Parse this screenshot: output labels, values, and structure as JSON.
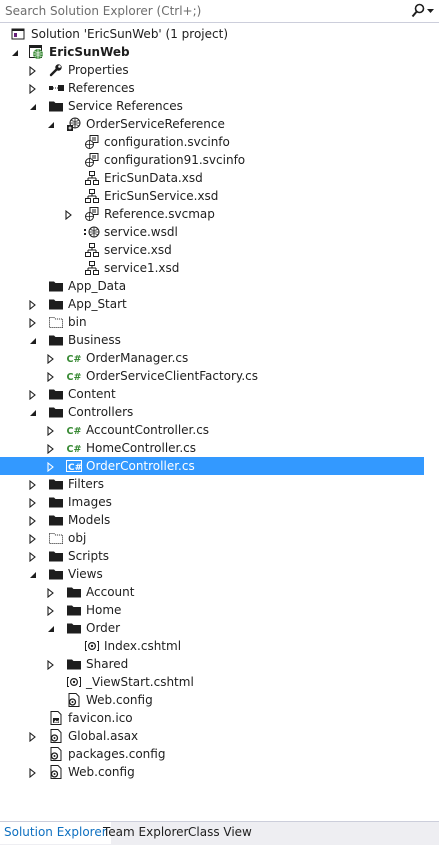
{
  "search": {
    "placeholder": "Search Solution Explorer (Ctrl+;)",
    "icon": "search-icon"
  },
  "tree": [
    {
      "label": "Solution 'EricSunWeb' (1 project)",
      "level": 0,
      "expander": "none",
      "icon": "solution",
      "name": "tree-item-solution"
    },
    {
      "label": "EricSunWeb",
      "level": 0,
      "expander": "expanded",
      "icon": "web-project",
      "bold": true,
      "name": "tree-item-ericsunweb"
    },
    {
      "label": "Properties",
      "level": 1,
      "expander": "collapsed",
      "icon": "wrench",
      "name": "tree-item-properties"
    },
    {
      "label": "References",
      "level": 1,
      "expander": "collapsed",
      "icon": "references",
      "name": "tree-item-references"
    },
    {
      "label": "Service References",
      "level": 1,
      "expander": "expanded",
      "icon": "folder",
      "name": "tree-item-service-references"
    },
    {
      "label": "OrderServiceReference",
      "level": 2,
      "expander": "expanded",
      "icon": "service-reference",
      "name": "tree-item-orderservicereference"
    },
    {
      "label": "configuration.svcinfo",
      "level": 3,
      "expander": "none",
      "icon": "svcinfo",
      "name": "tree-item-configuration-svcinfo"
    },
    {
      "label": "configuration91.svcinfo",
      "level": 3,
      "expander": "none",
      "icon": "svcinfo",
      "name": "tree-item-configuration91-svcinfo"
    },
    {
      "label": "EricSunData.xsd",
      "level": 3,
      "expander": "none",
      "icon": "xsd",
      "name": "tree-item-ericsundata-xsd"
    },
    {
      "label": "EricSunService.xsd",
      "level": 3,
      "expander": "none",
      "icon": "xsd",
      "name": "tree-item-ericsunservice-xsd"
    },
    {
      "label": "Reference.svcmap",
      "level": 3,
      "expander": "collapsed",
      "icon": "svcinfo",
      "name": "tree-item-reference-svcmap"
    },
    {
      "label": "service.wsdl",
      "level": 3,
      "expander": "none",
      "icon": "wsdl",
      "name": "tree-item-service-wsdl"
    },
    {
      "label": "service.xsd",
      "level": 3,
      "expander": "none",
      "icon": "xsd",
      "name": "tree-item-service-xsd"
    },
    {
      "label": "service1.xsd",
      "level": 3,
      "expander": "none",
      "icon": "xsd",
      "name": "tree-item-service1-xsd"
    },
    {
      "label": "App_Data",
      "level": 1,
      "expander": "none",
      "icon": "folder",
      "name": "tree-item-app-data"
    },
    {
      "label": "App_Start",
      "level": 1,
      "expander": "collapsed",
      "icon": "folder",
      "name": "tree-item-app-start"
    },
    {
      "label": "bin",
      "level": 1,
      "expander": "collapsed",
      "icon": "folder-hidden",
      "name": "tree-item-bin"
    },
    {
      "label": "Business",
      "level": 1,
      "expander": "expanded",
      "icon": "folder",
      "name": "tree-item-business"
    },
    {
      "label": "OrderManager.cs",
      "level": 2,
      "expander": "collapsed",
      "icon": "csharp",
      "name": "tree-item-ordermanager-cs"
    },
    {
      "label": "OrderServiceClientFactory.cs",
      "level": 2,
      "expander": "collapsed",
      "icon": "csharp",
      "name": "tree-item-orderserviceclientfactory-cs"
    },
    {
      "label": "Content",
      "level": 1,
      "expander": "collapsed",
      "icon": "folder",
      "name": "tree-item-content"
    },
    {
      "label": "Controllers",
      "level": 1,
      "expander": "expanded",
      "icon": "folder",
      "name": "tree-item-controllers"
    },
    {
      "label": "AccountController.cs",
      "level": 2,
      "expander": "collapsed",
      "icon": "csharp",
      "name": "tree-item-accountcontroller-cs"
    },
    {
      "label": "HomeController.cs",
      "level": 2,
      "expander": "collapsed",
      "icon": "csharp",
      "name": "tree-item-homecontroller-cs"
    },
    {
      "label": "OrderController.cs",
      "level": 2,
      "expander": "collapsed",
      "icon": "csharp",
      "selected": true,
      "name": "tree-item-ordercontroller-cs"
    },
    {
      "label": "Filters",
      "level": 1,
      "expander": "collapsed",
      "icon": "folder",
      "name": "tree-item-filters"
    },
    {
      "label": "Images",
      "level": 1,
      "expander": "collapsed",
      "icon": "folder",
      "name": "tree-item-images"
    },
    {
      "label": "Models",
      "level": 1,
      "expander": "collapsed",
      "icon": "folder",
      "name": "tree-item-models"
    },
    {
      "label": "obj",
      "level": 1,
      "expander": "collapsed",
      "icon": "folder-hidden",
      "name": "tree-item-obj"
    },
    {
      "label": "Scripts",
      "level": 1,
      "expander": "collapsed",
      "icon": "folder",
      "name": "tree-item-scripts"
    },
    {
      "label": "Views",
      "level": 1,
      "expander": "expanded",
      "icon": "folder",
      "name": "tree-item-views"
    },
    {
      "label": "Account",
      "level": 2,
      "expander": "collapsed",
      "icon": "folder",
      "name": "tree-item-views-account"
    },
    {
      "label": "Home",
      "level": 2,
      "expander": "collapsed",
      "icon": "folder",
      "name": "tree-item-views-home"
    },
    {
      "label": "Order",
      "level": 2,
      "expander": "expanded",
      "icon": "folder",
      "name": "tree-item-views-order"
    },
    {
      "label": "Index.cshtml",
      "level": 3,
      "expander": "none",
      "icon": "cshtml",
      "name": "tree-item-index-cshtml"
    },
    {
      "label": "Shared",
      "level": 2,
      "expander": "collapsed",
      "icon": "folder",
      "name": "tree-item-views-shared"
    },
    {
      "label": "_ViewStart.cshtml",
      "level": 2,
      "expander": "none",
      "icon": "cshtml",
      "name": "tree-item-viewstart-cshtml"
    },
    {
      "label": "Web.config",
      "level": 2,
      "expander": "none",
      "icon": "config",
      "name": "tree-item-views-web-config"
    },
    {
      "label": "favicon.ico",
      "level": 1,
      "expander": "none",
      "icon": "image-file",
      "name": "tree-item-favicon-ico"
    },
    {
      "label": "Global.asax",
      "level": 1,
      "expander": "collapsed",
      "icon": "config",
      "name": "tree-item-global-asax"
    },
    {
      "label": "packages.config",
      "level": 1,
      "expander": "none",
      "icon": "config",
      "name": "tree-item-packages-config"
    },
    {
      "label": "Web.config",
      "level": 1,
      "expander": "collapsed",
      "icon": "config",
      "name": "tree-item-web-config"
    }
  ],
  "bottom_tabs": [
    {
      "label": "Solution Explorer",
      "active": true,
      "name": "tab-solution-explorer"
    },
    {
      "label": "Team Explorer",
      "active": false,
      "name": "tab-team-explorer"
    },
    {
      "label": "Class View",
      "active": false,
      "name": "tab-class-view"
    }
  ],
  "colors": {
    "selection": "#3399ff",
    "folder": "#1e1e1e",
    "csharp": "#388a34",
    "active_tab_text": "#0e70c0",
    "tab_strip": "#eeeef2"
  }
}
